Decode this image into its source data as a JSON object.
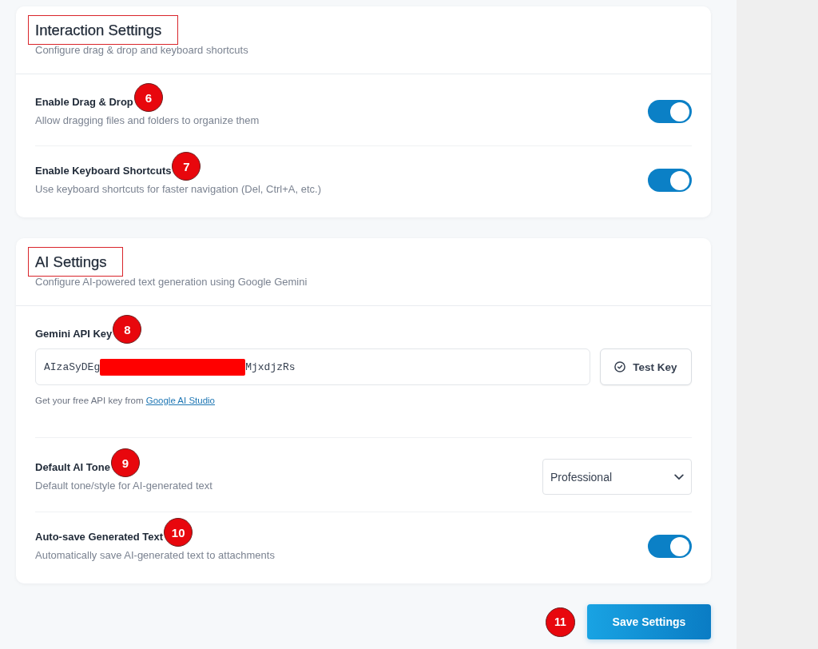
{
  "sections": [
    {
      "title": "Interaction Settings",
      "title_highlighted": true,
      "subtitle": "Configure drag & drop and keyboard shortcuts",
      "rows": [
        {
          "kind": "toggle",
          "label": "Enable Drag & Drop",
          "badge": "6",
          "description": "Allow dragging files and folders to organize them",
          "on": true
        },
        {
          "kind": "toggle",
          "label": "Enable Keyboard Shortcuts",
          "badge": "7",
          "description": "Use keyboard shortcuts for faster navigation (Del, Ctrl+A, etc.)",
          "on": true
        }
      ]
    },
    {
      "title": "AI Settings",
      "title_highlighted": true,
      "subtitle": "Configure AI-powered text generation using Google Gemini",
      "rows": [
        {
          "kind": "api_key",
          "label": "Gemini API Key",
          "badge": "8",
          "value_start": "AIzaSyDEg",
          "redacted": true,
          "value_end": "MjxdjzRs",
          "button": "Test Key",
          "help": "Get your free API key from",
          "link": "Google AI Studio"
        },
        {
          "kind": "select",
          "label": "Default AI Tone",
          "badge": "9",
          "description": "Default tone/style for AI-generated text",
          "value": "Professional"
        },
        {
          "kind": "toggle",
          "label": "Auto-save Generated Text",
          "badge": "10",
          "description": "Automatically save AI-generated text to attachments",
          "on": true
        }
      ]
    }
  ],
  "footer": {
    "badge": "11",
    "button": "Save Settings"
  }
}
